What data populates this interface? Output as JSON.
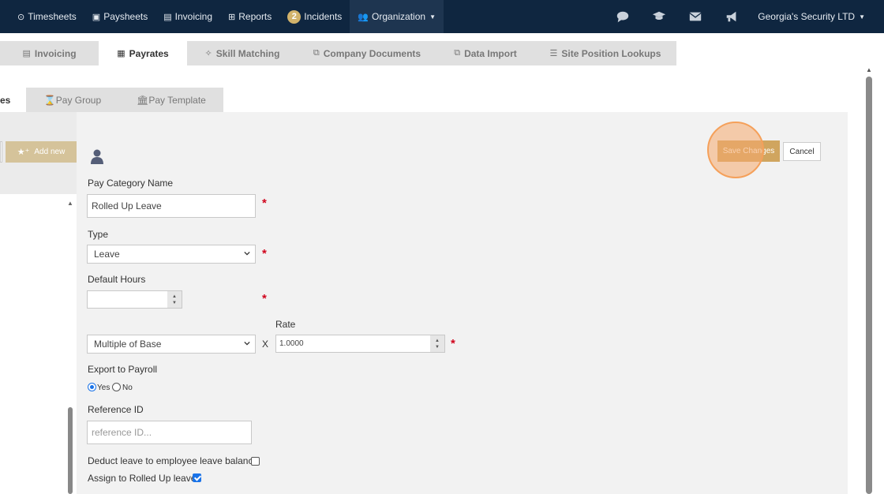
{
  "topnav": {
    "items": [
      {
        "label": "Timesheets",
        "icon": "clock-icon"
      },
      {
        "label": "Paysheets",
        "icon": "money-icon"
      },
      {
        "label": "Invoicing",
        "icon": "invoice-icon"
      },
      {
        "label": "Reports",
        "icon": "table-icon"
      },
      {
        "label": "Incidents",
        "badge": "2"
      },
      {
        "label": "Organization",
        "icon": "users-icon"
      }
    ],
    "right_icons": [
      "chat-icon",
      "graduation-cap-icon",
      "envelope-icon",
      "megaphone-icon"
    ],
    "account": "Georgia's Security LTD"
  },
  "main_tabs": [
    {
      "label": "Invoicing",
      "icon": "invoice-icon"
    },
    {
      "label": "Payrates",
      "icon": "calendar-icon"
    },
    {
      "label": "Skill Matching",
      "icon": "crosshair-icon"
    },
    {
      "label": "Company Documents",
      "icon": "copy-icon"
    },
    {
      "label": "Data Import",
      "icon": "copy-icon"
    },
    {
      "label": "Site Position Lookups",
      "icon": "list-icon"
    }
  ],
  "sub_tabs": [
    {
      "label": "es"
    },
    {
      "label": "Pay Group",
      "icon": "hourglass-icon"
    },
    {
      "label": "Pay Template",
      "icon": "bank-icon"
    }
  ],
  "left": {
    "add_new": "Add new"
  },
  "form": {
    "pay_category_name_label": "Pay Category Name",
    "pay_category_name_value": "Rolled Up Leave",
    "type_label": "Type",
    "type_value": "Leave",
    "default_hours_label": "Default Hours",
    "default_hours_value": "",
    "rate_label": "Rate",
    "rate_mode_value": "Multiple of Base",
    "x_symbol": "X",
    "rate_value": "1.0000",
    "export_label": "Export to Payroll",
    "export_yes": "Yes",
    "export_no": "No",
    "export_selected": "Yes",
    "reference_label": "Reference ID",
    "reference_placeholder": "reference ID...",
    "deduct_label": "Deduct leave to employee leave balance",
    "deduct_checked": false,
    "assign_label": "Assign to Rolled Up leave",
    "assign_checked": true,
    "required_mark": "*"
  },
  "actions": {
    "save": "Save Changes",
    "cancel": "Cancel"
  },
  "colors": {
    "nav_bg": "#0f2640",
    "gold": "#d0a55f",
    "required": "#d0021b"
  }
}
